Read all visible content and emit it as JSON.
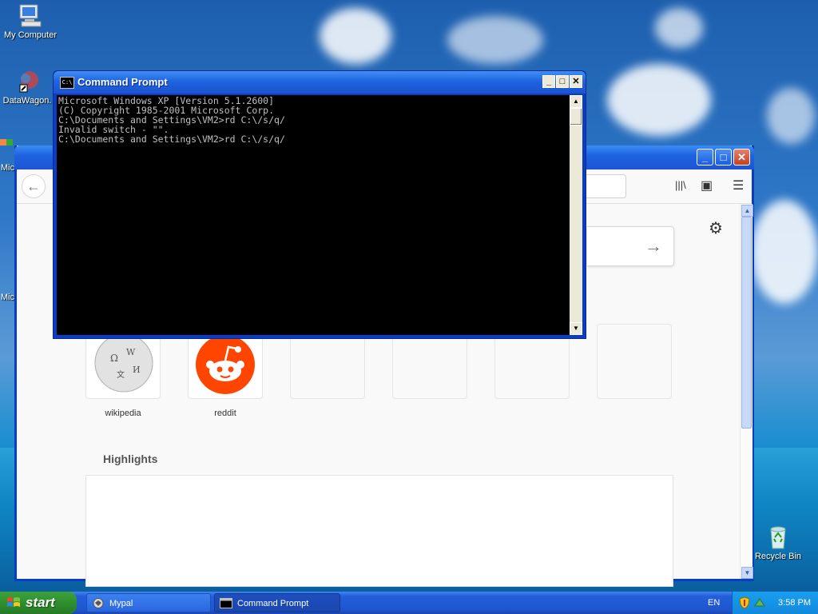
{
  "desktop": {
    "icons": [
      {
        "label": "My Computer"
      },
      {
        "label": "DataWagon."
      },
      {
        "label": "Mic"
      },
      {
        "label": "Mic"
      },
      {
        "label": "Recycle Bin"
      }
    ]
  },
  "browser": {
    "top_sites": [
      {
        "label": "wikipedia"
      },
      {
        "label": "reddit"
      },
      {
        "label": ""
      },
      {
        "label": ""
      },
      {
        "label": ""
      },
      {
        "label": ""
      }
    ],
    "highlights_title": "Highlights",
    "controls": {
      "minimize": "_",
      "maximize": "□",
      "close": "✕",
      "back": "←",
      "search_go": "→",
      "settings": "⚙",
      "library": "|||\\",
      "sidebar": "▣",
      "menu": "☰"
    }
  },
  "cmd": {
    "title": "Command Prompt",
    "icon_text": "C:\\",
    "lines": [
      "Microsoft Windows XP [Version 5.1.2600]",
      "(C) Copyright 1985-2001 Microsoft Corp.",
      "",
      "C:\\Documents and Settings\\VM2>rd C:\\/s/q/",
      "Invalid switch - \"\".",
      "",
      "C:\\Documents and Settings\\VM2>rd C:\\/s/q/"
    ],
    "controls": {
      "minimize": "_",
      "maximize": "□",
      "close": "✕"
    }
  },
  "taskbar": {
    "start_label": "start",
    "tasks": [
      {
        "label": "Mypal",
        "active": false
      },
      {
        "label": "Command Prompt",
        "active": true
      }
    ],
    "language": "EN",
    "time": "3:58 PM"
  }
}
